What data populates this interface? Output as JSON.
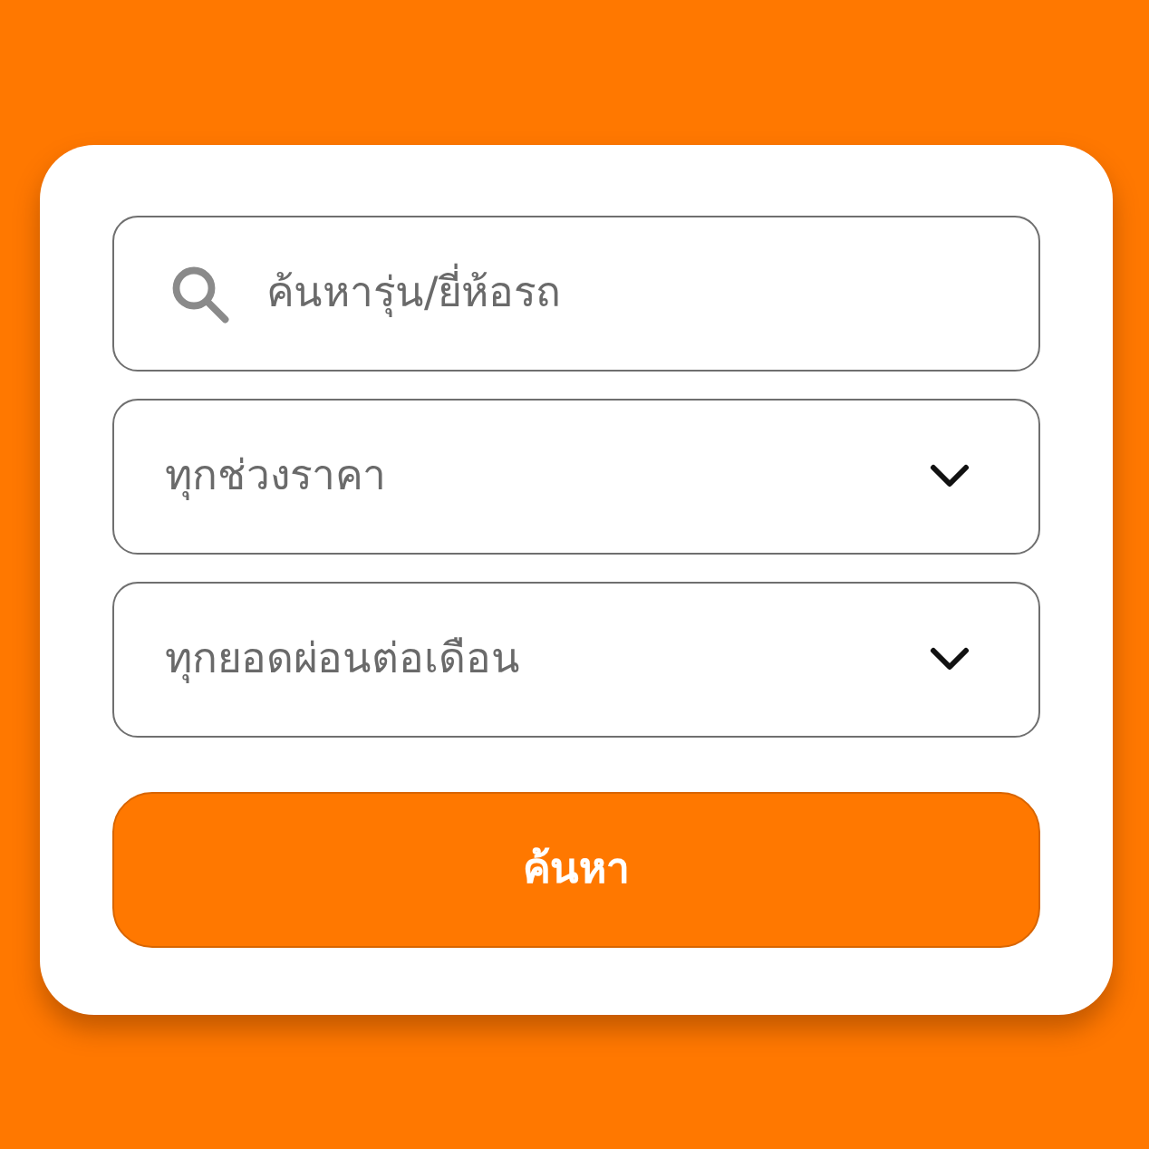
{
  "search": {
    "placeholder": "ค้นหารุ่น/ยี่ห้อรถ"
  },
  "dropdowns": [
    {
      "value": "ทุกช่วงราคา"
    },
    {
      "value": "ทุกยอดผ่อนต่อเดือน"
    }
  ],
  "button": {
    "label": "ค้นหา"
  }
}
